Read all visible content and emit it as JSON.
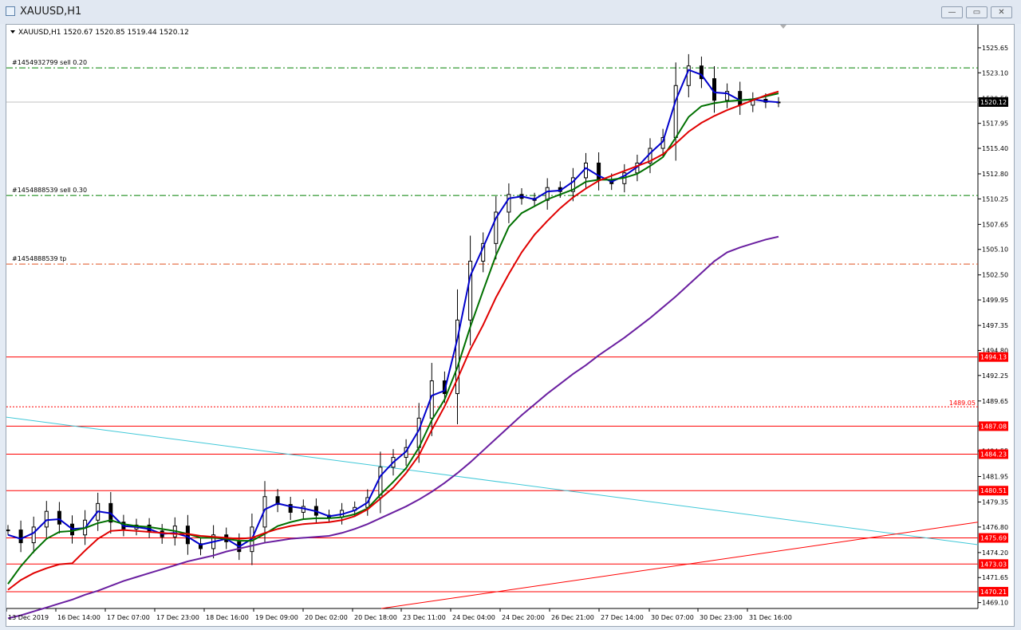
{
  "window": {
    "title": "XAUUSD,H1",
    "minimize_glyph": "—",
    "maximize_glyph": "▭",
    "close_glyph": "✕"
  },
  "chart_header": "XAUUSD,H1  1520.67 1520.85 1519.44 1520.12",
  "colors": {
    "ma_fast": "#0000cc",
    "ma_mid": "#007000",
    "ma_slow": "#e00000",
    "ma_long": "#6a1fa0",
    "hline": "#ff0000",
    "trendline_cyan": "#40c8d8",
    "order_line": "#008000",
    "tp_line": "#e05020"
  },
  "chart_data": {
    "type": "line",
    "symbol": "XAUUSD",
    "timeframe": "H1",
    "ohlc_header": {
      "open": 1520.67,
      "high": 1520.85,
      "low": 1519.44,
      "close": 1520.12
    },
    "current_price": "1520.12",
    "x_ticks": [
      "13 Dec 2019",
      "16 Dec 14:00",
      "17 Dec 07:00",
      "17 Dec 23:00",
      "18 Dec 16:00",
      "19 Dec 09:00",
      "20 Dec 02:00",
      "20 Dec 18:00",
      "23 Dec 11:00",
      "24 Dec 04:00",
      "24 Dec 20:00",
      "26 Dec 21:00",
      "27 Dec 14:00",
      "30 Dec 07:00",
      "30 Dec 23:00",
      "31 Dec 16:00"
    ],
    "y_ticks": [
      "1525.65",
      "1523.10",
      "1520.50",
      "1517.95",
      "1515.40",
      "1512.80",
      "1510.25",
      "1507.65",
      "1505.10",
      "1502.50",
      "1499.95",
      "1497.35",
      "1494.80",
      "1492.25",
      "1489.65",
      "1487.10",
      "1484.55",
      "1481.95",
      "1479.35",
      "1476.80",
      "1474.20",
      "1471.65",
      "1469.10"
    ],
    "ylim": [
      1468.5,
      1528.0
    ],
    "price_series_x": [
      0,
      4,
      8,
      12,
      16,
      20,
      24,
      28,
      32,
      36,
      40,
      44,
      48,
      52,
      56,
      60,
      64,
      68,
      72,
      76,
      80,
      84,
      88,
      92,
      96,
      100,
      104,
      108,
      112,
      116,
      120,
      124,
      128,
      132,
      136,
      140,
      144,
      148,
      152,
      156,
      160,
      164,
      168,
      172,
      176,
      180,
      184,
      188,
      192,
      196,
      200,
      204,
      208,
      212,
      216,
      220,
      224,
      228,
      232,
      236,
      240
    ],
    "price_series_close": [
      1476.5,
      1475.2,
      1476.8,
      1478.4,
      1477.1,
      1476.0,
      1477.5,
      1479.2,
      1477.3,
      1476.6,
      1477.0,
      1476.4,
      1475.8,
      1476.9,
      1475.1,
      1474.6,
      1476.0,
      1475.3,
      1474.3,
      1476.8,
      1479.9,
      1479.1,
      1478.3,
      1478.9,
      1478.0,
      1477.8,
      1478.5,
      1478.8,
      1479.8,
      1482.9,
      1483.9,
      1484.9,
      1487.9,
      1491.7,
      1490.4,
      1497.9,
      1503.9,
      1505.7,
      1508.9,
      1510.7,
      1510.3,
      1510.1,
      1511.4,
      1511.0,
      1512.4,
      1513.9,
      1512.2,
      1511.8,
      1512.9,
      1513.9,
      1515.4,
      1516.5,
      1521.8,
      1523.8,
      1522.5,
      1520.3,
      1521.2,
      1519.8,
      1520.4,
      1520.1,
      1520.12
    ],
    "series": [
      {
        "name": "",
        "color": "#0000cc",
        "values": [
          1476.0,
          1475.6,
          1476.2,
          1477.5,
          1477.6,
          1476.6,
          1476.7,
          1478.4,
          1478.2,
          1476.9,
          1476.8,
          1476.6,
          1476.1,
          1476.2,
          1475.8,
          1475.0,
          1475.3,
          1475.6,
          1474.8,
          1475.6,
          1478.6,
          1479.2,
          1478.9,
          1478.7,
          1478.4,
          1477.9,
          1478.1,
          1478.5,
          1479.3,
          1482.0,
          1483.4,
          1484.5,
          1486.7,
          1490.2,
          1490.7,
          1496.0,
          1502.4,
          1505.3,
          1508.3,
          1510.3,
          1510.5,
          1510.2,
          1511.0,
          1511.1,
          1512.0,
          1513.4,
          1512.6,
          1512.0,
          1512.6,
          1513.5,
          1514.9,
          1516.1,
          1520.3,
          1523.4,
          1522.9,
          1521.1,
          1521.0,
          1520.3,
          1520.4,
          1520.2,
          1520.1
        ]
      },
      {
        "name": "",
        "color": "#007000",
        "values": [
          1471.0,
          1472.8,
          1474.3,
          1475.6,
          1476.3,
          1476.4,
          1476.7,
          1477.2,
          1477.5,
          1477.1,
          1476.9,
          1476.8,
          1476.6,
          1476.4,
          1476.1,
          1475.7,
          1475.7,
          1475.6,
          1475.4,
          1475.4,
          1476.1,
          1476.9,
          1477.3,
          1477.6,
          1477.7,
          1477.7,
          1477.8,
          1478.1,
          1478.7,
          1480.1,
          1481.4,
          1482.8,
          1484.9,
          1487.7,
          1489.8,
          1493.1,
          1497.2,
          1500.9,
          1504.5,
          1507.4,
          1508.8,
          1509.5,
          1510.2,
          1510.7,
          1511.2,
          1512.0,
          1512.2,
          1512.2,
          1512.4,
          1512.8,
          1513.6,
          1514.5,
          1516.5,
          1518.6,
          1519.7,
          1520.0,
          1520.2,
          1520.3,
          1520.4,
          1520.7,
          1521.0
        ]
      },
      {
        "name": "",
        "color": "#e00000",
        "values": [
          1470.4,
          1471.4,
          1472.1,
          1472.6,
          1473.0,
          1473.1,
          1474.4,
          1475.6,
          1476.4,
          1476.5,
          1476.4,
          1476.3,
          1476.2,
          1476.1,
          1476.1,
          1475.9,
          1475.8,
          1475.7,
          1475.6,
          1475.7,
          1476.2,
          1476.6,
          1476.9,
          1477.1,
          1477.2,
          1477.3,
          1477.5,
          1477.9,
          1478.6,
          1479.7,
          1480.8,
          1482.3,
          1484.1,
          1486.7,
          1489.1,
          1491.9,
          1494.9,
          1497.4,
          1500.2,
          1502.6,
          1504.8,
          1506.6,
          1508.0,
          1509.3,
          1510.4,
          1511.3,
          1512.1,
          1512.6,
          1513.1,
          1513.6,
          1514.1,
          1514.8,
          1515.9,
          1517.1,
          1518.0,
          1518.7,
          1519.3,
          1519.8,
          1520.3,
          1520.8,
          1521.2
        ]
      },
      {
        "name": "",
        "color": "#6a1fa0",
        "values": [
          1467.5,
          1467.8,
          1468.2,
          1468.6,
          1469.0,
          1469.4,
          1469.9,
          1470.3,
          1470.8,
          1471.3,
          1471.7,
          1472.1,
          1472.5,
          1472.9,
          1473.3,
          1473.6,
          1473.9,
          1474.3,
          1474.6,
          1474.9,
          1475.2,
          1475.4,
          1475.6,
          1475.7,
          1475.8,
          1475.9,
          1476.2,
          1476.6,
          1477.1,
          1477.7,
          1478.3,
          1478.9,
          1479.6,
          1480.4,
          1481.3,
          1482.3,
          1483.4,
          1484.6,
          1485.8,
          1487.0,
          1488.2,
          1489.3,
          1490.4,
          1491.4,
          1492.4,
          1493.3,
          1494.3,
          1495.2,
          1496.1,
          1497.1,
          1498.1,
          1499.2,
          1500.3,
          1501.5,
          1502.7,
          1503.9,
          1504.8,
          1505.3,
          1505.7,
          1506.1,
          1506.4
        ]
      }
    ],
    "horizontal_lines": [
      {
        "price": 1494.13,
        "label": "1494.13",
        "style": "solid"
      },
      {
        "price": 1487.08,
        "label": "1487.08",
        "style": "solid"
      },
      {
        "price": 1484.23,
        "label": "1484.23",
        "style": "solid"
      },
      {
        "price": 1480.51,
        "label": "1480.51",
        "style": "solid"
      },
      {
        "price": 1475.69,
        "label": "1475.69",
        "style": "solid"
      },
      {
        "price": 1473.03,
        "label": "1473.03",
        "style": "solid"
      },
      {
        "price": 1470.21,
        "label": "1470.21",
        "style": "solid"
      },
      {
        "price": 1489.05,
        "label": "1489.05",
        "style": "dotted"
      }
    ],
    "order_lines": [
      {
        "price": 1523.6,
        "label": "#1454932799 sell 0.20"
      },
      {
        "price": 1510.6,
        "label": "#1454888539 sell 0.30"
      },
      {
        "price": 1503.6,
        "label": "#1454888539 tp"
      }
    ]
  }
}
